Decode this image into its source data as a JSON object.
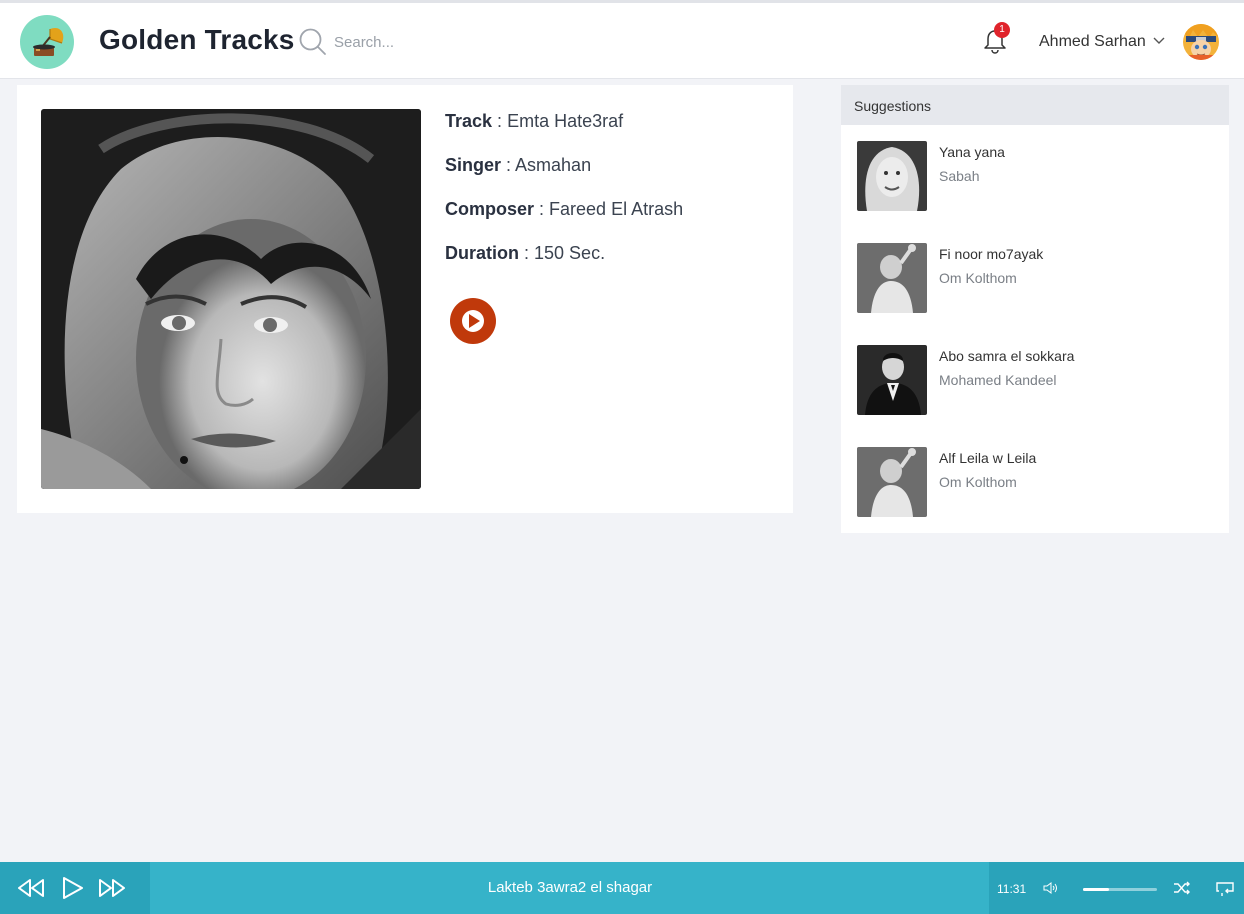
{
  "header": {
    "app_title": "Golden Tracks",
    "search_placeholder": "Search...",
    "notification_count": "1",
    "user_name": "Ahmed Sarhan"
  },
  "track": {
    "track_key": "Track",
    "track_value": "Emta Hate3raf",
    "singer_key": "Singer",
    "singer_value": "Asmahan",
    "composer_key": "Composer",
    "composer_value": "Fareed El Atrash",
    "duration_key": "Duration",
    "duration_value": "150 Sec."
  },
  "suggestions": {
    "heading": "Suggestions",
    "items": [
      {
        "title": "Yana yana",
        "artist": "Sabah"
      },
      {
        "title": "Fi noor mo7ayak",
        "artist": "Om Kolthom"
      },
      {
        "title": "Abo samra el sokkara",
        "artist": "Mohamed Kandeel"
      },
      {
        "title": "Alf Leila w Leila",
        "artist": "Om Kolthom"
      }
    ]
  },
  "player": {
    "now_playing": "Lakteb 3awra2 el shagar",
    "time": "11:31",
    "volume_fraction": 0.35
  },
  "colors": {
    "accent": "#36b3c9",
    "play_button": "#c0390b",
    "badge": "#e0242c"
  }
}
